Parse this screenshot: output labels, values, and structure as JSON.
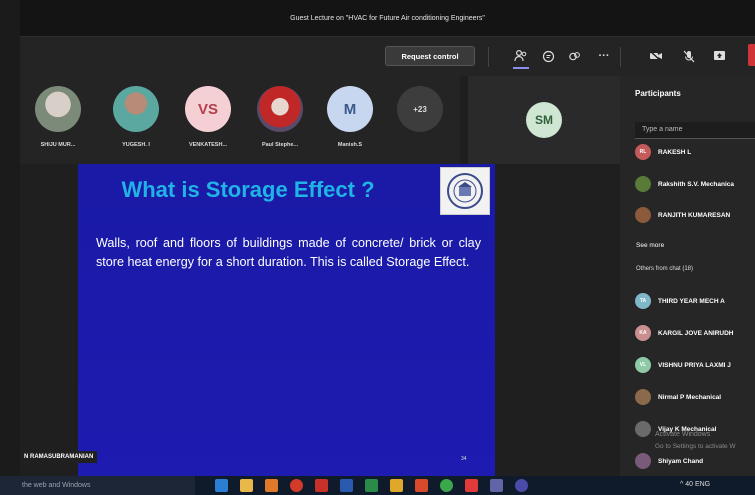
{
  "window": {
    "title": "Guest Lecture on \"HVAC for Future Air conditioning Engineers\""
  },
  "toolbar": {
    "request_control": "Request control",
    "icons": [
      "people-icon",
      "chat-icon",
      "reactions-icon",
      "more-icon",
      "camera-off-icon",
      "mic-off-icon",
      "share-icon"
    ]
  },
  "videos": {
    "tiles": [
      {
        "name": "SHIJU MUR...",
        "initials": "",
        "photo": true
      },
      {
        "name": "YUGESH. I",
        "initials": "",
        "photo": true
      },
      {
        "name": "VENKATESH...",
        "initials": "VS",
        "photo": false
      },
      {
        "name": "Paul Stephe...",
        "initials": "",
        "photo": true
      },
      {
        "name": "Manish.S",
        "initials": "M",
        "photo": false
      }
    ],
    "overflow_count": "+23",
    "featured_initials": "SM"
  },
  "slide": {
    "title": "What is Storage Effect ?",
    "body": "Walls, roof and floors of buildings made of concrete/ brick or clay store heat energy for a short duration. This is called Storage Effect.",
    "page_number": "34",
    "presenter": "N RAMASUBRAMANIAN"
  },
  "participants": {
    "title": "Participants",
    "search_placeholder": "Type a name",
    "people": [
      {
        "name": "RAKESH L",
        "initials": "RL",
        "color": "#c45a5a"
      },
      {
        "name": "Rakshith S.V. Mechanica",
        "initials": "",
        "color": "#5a7a3a"
      },
      {
        "name": "RANJITH KUMARESAN",
        "initials": "",
        "color": "#8a5a3a"
      }
    ],
    "see_more": "See more",
    "others_label": "Others from chat (18)",
    "chat_people": [
      {
        "name": "THIRD YEAR MECH A",
        "initials": "TA",
        "color": "#7fb7c9"
      },
      {
        "name": "KARGIL JOVE ANIRUDH",
        "initials": "KA",
        "color": "#c98f8f"
      },
      {
        "name": "VISHNU PRIYA LAXMI J",
        "initials": "VL",
        "color": "#8fc9a5"
      },
      {
        "name": "Nirmal P Mechanical",
        "initials": "",
        "color": "#8a6a4a"
      },
      {
        "name": "Vijay K Mechanical",
        "initials": "",
        "color": "#6a6a6a"
      },
      {
        "name": "Shiyam Chand",
        "initials": "",
        "color": "#7a5a7a"
      }
    ]
  },
  "watermark": {
    "line1": "Activate Windows",
    "line2": "Go to Settings to activate W"
  },
  "taskbar": {
    "search_text": "the web and Windows",
    "tray_text": "^ 40 ENG"
  }
}
